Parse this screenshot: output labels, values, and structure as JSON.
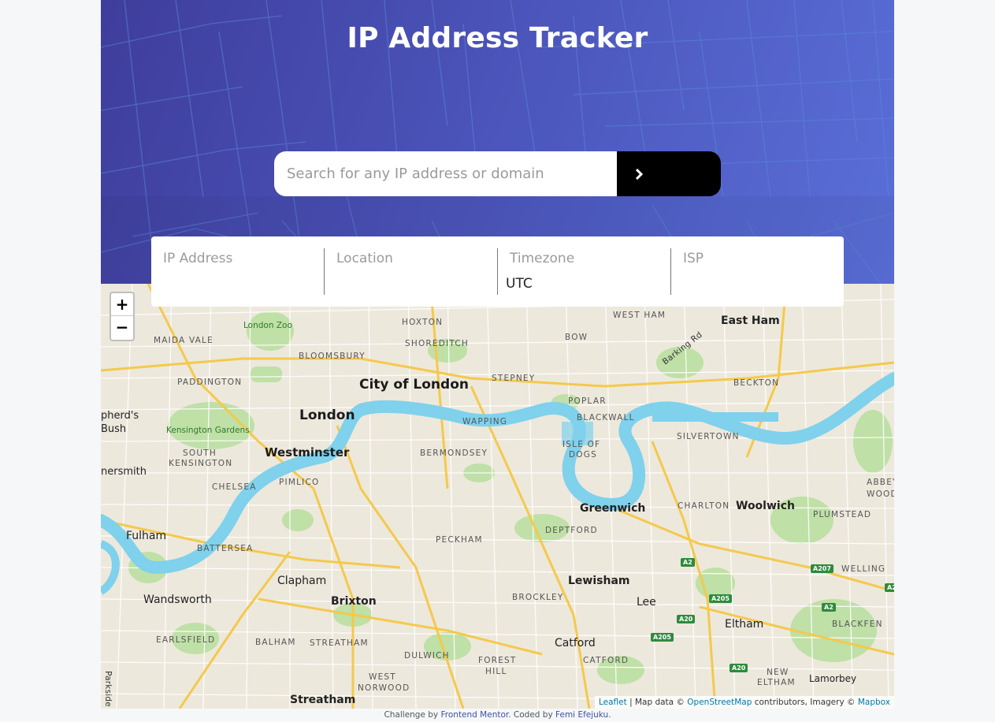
{
  "header": {
    "title": "IP Address Tracker"
  },
  "search": {
    "placeholder": "Search for any IP address or domain",
    "value": "",
    "button_icon": "chevron-right-icon"
  },
  "info": {
    "ip_label": "IP Address",
    "ip_value": "",
    "location_label": "Location",
    "location_value": "",
    "timezone_label": "Timezone",
    "timezone_value": "UTC",
    "isp_label": "ISP",
    "isp_value": ""
  },
  "map": {
    "zoom_in": "+",
    "zoom_out": "−",
    "labels": {
      "city_of_london": "City of London",
      "london": "London",
      "westminster": "Westminster",
      "east_ham": "East Ham",
      "greenwich": "Greenwich",
      "woolwich": "Woolwich",
      "lewisham": "Lewisham",
      "brixton": "Brixton",
      "clapham": "Clapham",
      "fulham": "Fulham",
      "wandsworth": "Wandsworth",
      "streatham": "Streatham",
      "catford": "Catford",
      "eltham": "Eltham",
      "lee": "Lee",
      "lamorbey": "Lamorbey",
      "london_zoo": "London Zoo",
      "kensington_gardens": "Kensington Gardens",
      "hoxton": "HOXTON",
      "shoreditch": "SHOREDITCH",
      "west_ham": "WEST HAM",
      "bow": "BOW",
      "maida_vale": "MAIDA VALE",
      "bloomsbury": "BLOOMSBURY",
      "paddington": "PADDINGTON",
      "stepney": "STEPNEY",
      "poplar": "POPLAR",
      "blackwall": "BLACKWALL",
      "beckton": "BECKTON",
      "wapping": "WAPPING",
      "silvertown": "SILVERTOWN",
      "isle_of": "ISLE OF",
      "dogs": "DOGS",
      "south": "SOUTH",
      "kensington": "KENSINGTON",
      "bermondsey": "BERMONDSEY",
      "chelsea": "CHELSEA",
      "pimlico": "PIMLICO",
      "charlton": "CHARLTON",
      "plumstead": "PLUMSTEAD",
      "abbey": "ABBEY",
      "wood": "WOOD",
      "battersea": "BATTERSEA",
      "peckham": "PECKHAM",
      "deptford": "DEPTFORD",
      "brockley": "BROCKLEY",
      "welling": "WELLING",
      "blackfen": "BLACKFEN",
      "earlsfield": "EARLSFIELD",
      "balham": "BALHAM",
      "streatham_small": "STREATHAM",
      "dulwich": "DULWICH",
      "forest": "FOREST",
      "hill": "HILL",
      "catford_small": "CATFORD",
      "west": "WEST",
      "norwood": "NORWOOD",
      "new": "NEW",
      "eltham_small": "ELTHAM",
      "shepherds": "pherd's",
      "bush": "Bush",
      "hammersmith": "nersmith",
      "barking_rd": "Barking Rd",
      "parkside": "Parkside"
    },
    "shields": [
      "A2",
      "A207",
      "A205",
      "A20",
      "A2",
      "A205",
      "A20",
      "A2"
    ],
    "attribution": {
      "leaflet": "Leaflet",
      "sep": " | Map data © ",
      "osm": "OpenStreetMap",
      "mid": " contributors, Imagery © ",
      "mapbox": "Mapbox"
    }
  },
  "footer": {
    "prefix": "Challenge by ",
    "fm": "Frontend Mentor",
    "mid": ". Coded by ",
    "author": "Femi Efejuku",
    "suffix": "."
  },
  "colors": {
    "hero_start": "#3f3d9c",
    "hero_end": "#5a6fd9",
    "river": "#7fd1ec",
    "road": "#f3c84a",
    "park": "#b5dc98"
  }
}
